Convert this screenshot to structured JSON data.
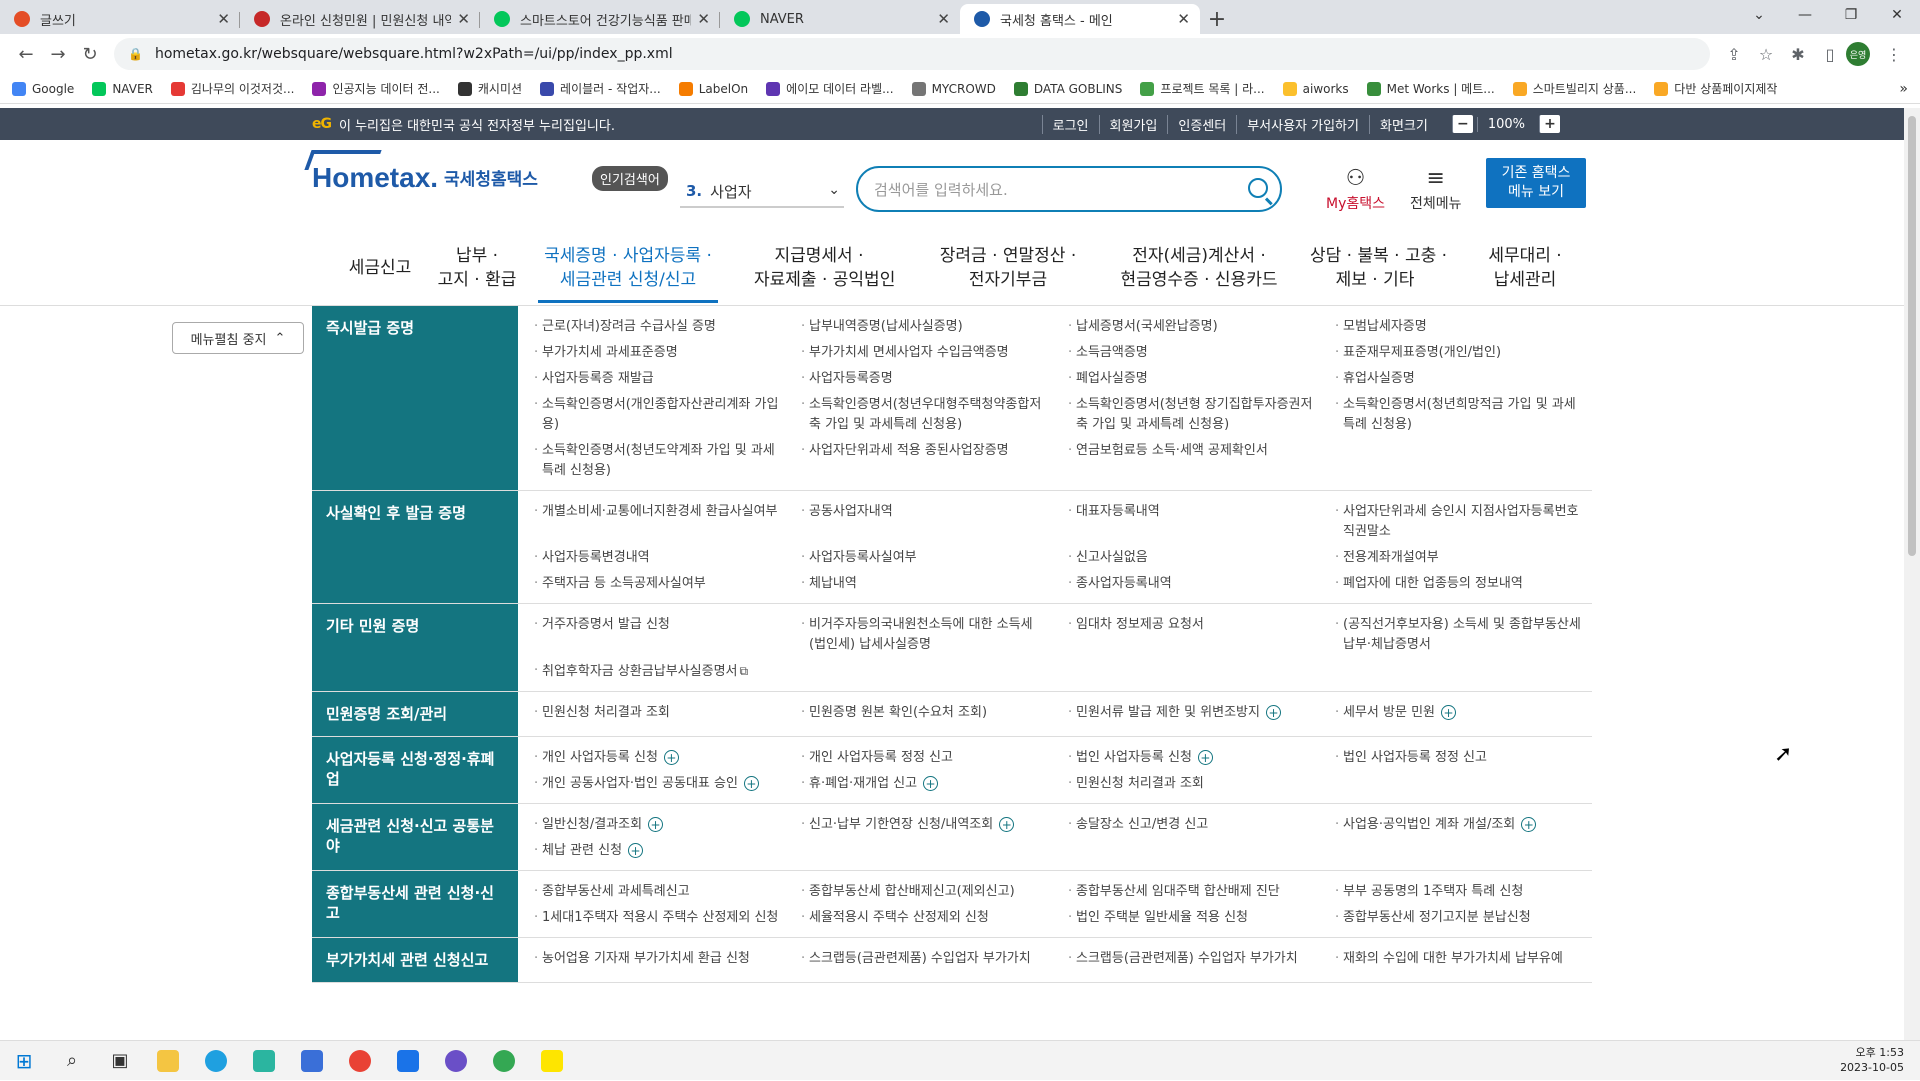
{
  "browser": {
    "tabs": [
      {
        "title": "글쓰기",
        "color": "#e44d26"
      },
      {
        "title": "온라인 신청민원 | 민원신청 내역",
        "color": "#c62828"
      },
      {
        "title": "스마트스토어 건강기능식품 판매",
        "color": "#03c75a"
      },
      {
        "title": "NAVER",
        "color": "#03c75a"
      },
      {
        "title": "국세청 홈택스 - 메인",
        "color": "#1e5aa8"
      }
    ],
    "url": "hometax.go.kr/websquare/websquare.html?w2xPath=/ui/pp/index_pp.xml",
    "profile": "은영",
    "bookmarks": [
      {
        "label": "Google",
        "color": "#4285f4"
      },
      {
        "label": "NAVER",
        "color": "#03c75a"
      },
      {
        "label": "김나무의 이것저것...",
        "color": "#e53935"
      },
      {
        "label": "인공지능 데이터 전...",
        "color": "#8e24aa"
      },
      {
        "label": "캐시미션",
        "color": "#333333"
      },
      {
        "label": "레이블러 - 작업자...",
        "color": "#3949ab"
      },
      {
        "label": "LabelOn",
        "color": "#f57c00"
      },
      {
        "label": "에이모 데이터 라벨...",
        "color": "#5e35b1"
      },
      {
        "label": "MYCROWD",
        "color": "#757575"
      },
      {
        "label": "DATA GOBLINS",
        "color": "#2e7d32"
      },
      {
        "label": "프로젝트 목록 | 라...",
        "color": "#43a047"
      },
      {
        "label": "aiworks",
        "color": "#fbc02d"
      },
      {
        "label": "Met Works | 메트...",
        "color": "#388e3c"
      },
      {
        "label": "스마트빌리지 상품...",
        "color": "#f9a825"
      },
      {
        "label": "다반 상품페이지제작",
        "color": "#f9a825"
      }
    ]
  },
  "govbar": {
    "logo": "eG",
    "notice": "이 누리집은 대한민국 공식 전자정부 누리집입니다.",
    "links": [
      "로그인",
      "회원가입",
      "인증센터",
      "부서사용자 가입하기",
      "화면크기"
    ],
    "zoom": "100%"
  },
  "header": {
    "logo_text": "Hometax.",
    "logo_kr": "국세청홈택스",
    "popular_label": "인기검색어",
    "popular_num": "3.",
    "popular_word": "사업자",
    "search_placeholder": "검색어를 입력하세요.",
    "mytax": "My홈택스",
    "allmenu": "전체메뉴",
    "oldmenu_1": "기존 홈택스",
    "oldmenu_2": "메뉴 보기"
  },
  "gnb": [
    {
      "l1": "세금신고",
      "l2": ""
    },
    {
      "l1": "납부 ·",
      "l2": "고지 · 환급"
    },
    {
      "l1": "국세증명 · 사업자등록 ·",
      "l2": "세금관련 신청/신고"
    },
    {
      "l1": "지급명세서 ·",
      "l2": "자료제출 · 공익법인"
    },
    {
      "l1": "장려금 · 연말정산 ·",
      "l2": "전자기부금"
    },
    {
      "l1": "전자(세금)계산서 ·",
      "l2": "현금영수증 · 신용카드"
    },
    {
      "l1": "상담 · 불복 · 고충 ·",
      "l2": "제보 · 기타"
    },
    {
      "l1": "세무대리 ·",
      "l2": "납세관리"
    }
  ],
  "fold_button": "메뉴펼침 중지",
  "menu": [
    {
      "label": "즉시발급 증명",
      "items": [
        "근로(자녀)장려금 수급사실 증명",
        "납부내역증명(납세사실증명)",
        "납세증명서(국세완납증명)",
        "모범납세자증명",
        "부가가치세 과세표준증명",
        "부가가치세 면세사업자 수입금액증명",
        "소득금액증명",
        "표준재무제표증명(개인/법인)",
        "사업자등록증 재발급",
        "사업자등록증명",
        "폐업사실증명",
        "휴업사실증명",
        "소득확인증명서(개인종합자산관리계좌 가입용)",
        "소득확인증명서(청년우대형주택청약종합저축 가입 및 과세특례 신청용)",
        "소득확인증명서(청년형 장기집합투자증권저축 가입 및 과세특례 신청용)",
        "소득확인증명서(청년희망적금 가입 및 과세특례 신청용)",
        "소득확인증명서(청년도약계좌 가입 및 과세특례 신청용)",
        "사업자단위과세 적용 종된사업장증명",
        "연금보험료등 소득·세액 공제확인서"
      ]
    },
    {
      "label": "사실확인 후 발급 증명",
      "items": [
        "개별소비세·교통에너지환경세 환급사실여부",
        "공동사업자내역",
        "대표자등록내역",
        "사업자단위과세 승인시 지점사업자등록번호 직권말소",
        "사업자등록변경내역",
        "사업자등록사실여부",
        "신고사실없음",
        "전용계좌개설여부",
        "주택자금 등 소득공제사실여부",
        "체납내역",
        "종사업자등록내역",
        "폐업자에 대한 업종등의 정보내역"
      ]
    },
    {
      "label": "기타 민원 증명",
      "items": [
        "거주자증명서 발급 신청",
        "비거주자등의국내원천소득에 대한 소득세(법인세) 납세사실증명",
        "임대차 정보제공 요청서",
        "(공직선거후보자용) 소득세 및 종합부동산세 납부·체납증명서",
        "취업후학자금 상환금납부사실증명서"
      ],
      "ext": [
        4
      ]
    },
    {
      "label": "민원증명 조회/관리",
      "items": [
        "민원신청 처리결과 조회",
        "민원증명 원본 확인(수요처 조회)",
        "민원서류 발급 제한 및 위변조방지",
        "세무서 방문 민원"
      ],
      "plus": [
        2,
        3
      ]
    },
    {
      "label": "사업자등록 신청·정정·휴폐업",
      "items": [
        "개인 사업자등록 신청",
        "개인 사업자등록 정정 신고",
        "법인 사업자등록 신청",
        "법인 사업자등록 정정 신고",
        "개인 공동사업자·법인 공동대표 승인",
        "휴·폐업·재개업 신고",
        "민원신청 처리결과 조회"
      ],
      "plus": [
        0,
        2,
        4,
        5
      ]
    },
    {
      "label": "세금관련 신청·신고 공통분야",
      "items": [
        "일반신청/결과조회",
        "신고·납부 기한연장 신청/내역조회",
        "송달장소 신고/변경 신고",
        "사업용·공익법인 계좌 개설/조회",
        "체납 관련 신청"
      ],
      "plus": [
        0,
        1,
        3,
        4
      ]
    },
    {
      "label": "종합부동산세 관련 신청·신고",
      "items": [
        "종합부동산세 과세특례신고",
        "종합부동산세 합산배제신고(제외신고)",
        "종합부동산세 임대주택 합산배제 진단",
        "부부 공동명의 1주택자 특례 신청",
        "1세대1주택자 적용시 주택수 산정제외 신청",
        "세율적용시 주택수 산정제외 신청",
        "법인 주택분 일반세율 적용 신청",
        "종합부동산세 정기고지분 분납신청"
      ]
    },
    {
      "label": "부가가치세 관련 신청신고",
      "items": [
        "농어업용 기자재 부가가치세 환급 신청",
        "스크랩등(금관련제품) 수입업자 부가가치",
        "스크랩등(금관련제품) 수입업자 부가가치",
        "재화의 수입에 대한 부가가치세 납부유예"
      ]
    }
  ],
  "taskbar": {
    "time": "오후 1:53",
    "date": "2023-10-05"
  }
}
